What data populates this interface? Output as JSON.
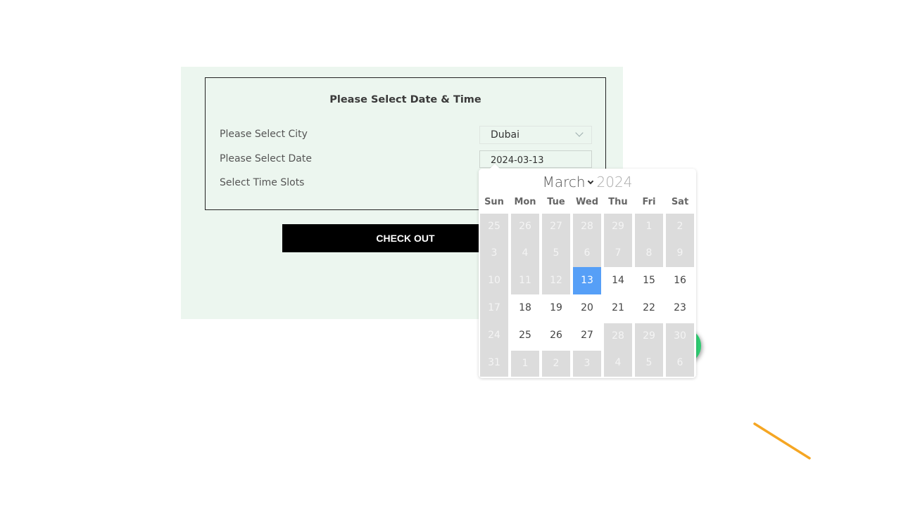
{
  "form": {
    "title": "Please Select Date & Time",
    "city_label": "Please Select City",
    "city_value": "Dubai",
    "date_label": "Please Select Date",
    "date_value": "2024-03-13",
    "time_label": "Select Time Slots",
    "checkout_label": "CHECK OUT"
  },
  "calendar": {
    "month": "March",
    "year": "2024",
    "weekdays": [
      "Sun",
      "Mon",
      "Tue",
      "Wed",
      "Thu",
      "Fri",
      "Sat"
    ],
    "selected": "13",
    "weeks": [
      [
        {
          "d": "25",
          "s": "disabled"
        },
        {
          "d": "26",
          "s": "disabled"
        },
        {
          "d": "27",
          "s": "disabled"
        },
        {
          "d": "28",
          "s": "disabled"
        },
        {
          "d": "29",
          "s": "disabled"
        },
        {
          "d": "1",
          "s": "disabled"
        },
        {
          "d": "2",
          "s": "disabled"
        }
      ],
      [
        {
          "d": "3",
          "s": "disabled"
        },
        {
          "d": "4",
          "s": "disabled"
        },
        {
          "d": "5",
          "s": "disabled"
        },
        {
          "d": "6",
          "s": "disabled"
        },
        {
          "d": "7",
          "s": "disabled"
        },
        {
          "d": "8",
          "s": "disabled"
        },
        {
          "d": "9",
          "s": "disabled"
        }
      ],
      [
        {
          "d": "10",
          "s": "disabled"
        },
        {
          "d": "11",
          "s": "disabled"
        },
        {
          "d": "12",
          "s": "disabled"
        },
        {
          "d": "13",
          "s": "selected"
        },
        {
          "d": "14",
          "s": "available"
        },
        {
          "d": "15",
          "s": "available"
        },
        {
          "d": "16",
          "s": "available"
        }
      ],
      [
        {
          "d": "17",
          "s": "disabled"
        },
        {
          "d": "18",
          "s": "available"
        },
        {
          "d": "19",
          "s": "available"
        },
        {
          "d": "20",
          "s": "available"
        },
        {
          "d": "21",
          "s": "available"
        },
        {
          "d": "22",
          "s": "available"
        },
        {
          "d": "23",
          "s": "available"
        }
      ],
      [
        {
          "d": "24",
          "s": "disabled"
        },
        {
          "d": "25",
          "s": "available"
        },
        {
          "d": "26",
          "s": "available"
        },
        {
          "d": "27",
          "s": "available"
        },
        {
          "d": "28",
          "s": "disabled"
        },
        {
          "d": "29",
          "s": "disabled"
        },
        {
          "d": "30",
          "s": "disabled"
        }
      ],
      [
        {
          "d": "31",
          "s": "disabled"
        },
        {
          "d": "1",
          "s": "disabled"
        },
        {
          "d": "2",
          "s": "disabled"
        },
        {
          "d": "3",
          "s": "disabled"
        },
        {
          "d": "4",
          "s": "disabled"
        },
        {
          "d": "5",
          "s": "disabled"
        },
        {
          "d": "6",
          "s": "disabled"
        }
      ]
    ]
  },
  "colors": {
    "panel_bg": "#ecf6ef",
    "selected_day": "#569ff7",
    "disabled_day": "#dcdcdc",
    "checkout_bg": "#000000",
    "chat_button": "#2ecc71",
    "annotation_line": "#f5a623"
  }
}
